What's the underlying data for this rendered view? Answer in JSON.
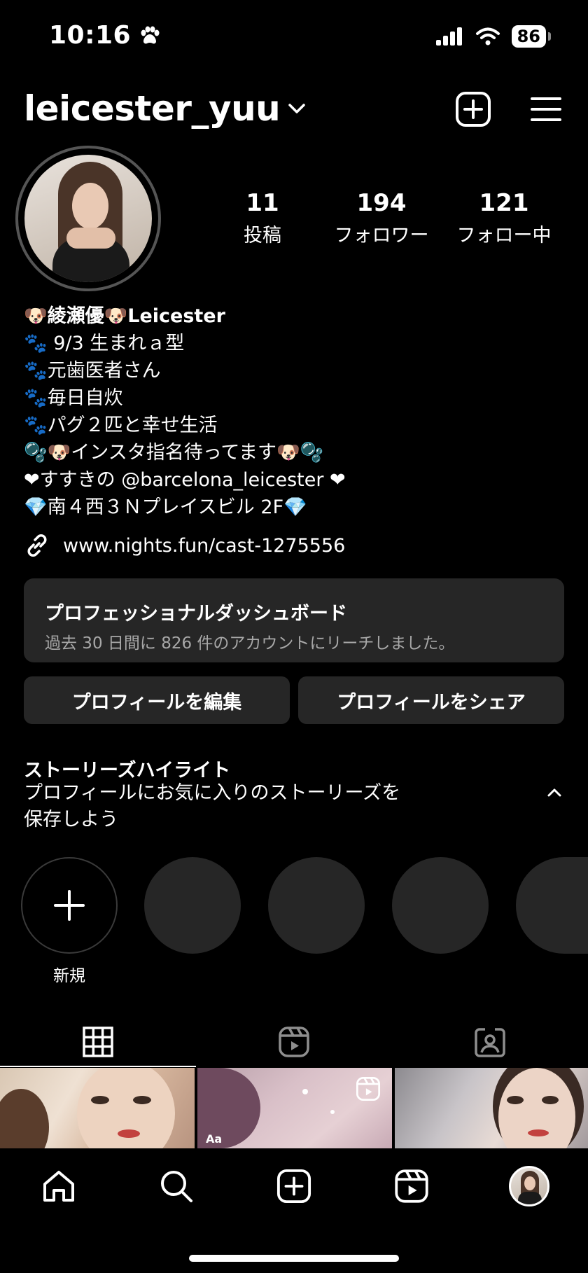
{
  "status_bar": {
    "time": "10:16",
    "battery": "86"
  },
  "header": {
    "username": "leicester_yuu"
  },
  "stats": [
    {
      "num": "11",
      "label": "投稿"
    },
    {
      "num": "194",
      "label": "フォロワー"
    },
    {
      "num": "121",
      "label": "フォロー中"
    }
  ],
  "bio": {
    "name": "🐶綾瀬優🐶Leicester",
    "lines": [
      "🐾 9/3 生まれａ型",
      "🐾元歯医者さん",
      "🐾毎日自炊",
      "🐾パグ２匹と幸せ生活",
      "🫧🐶インスタ指名待ってます🐶🫧",
      "❤すすきの @barcelona_leicester ❤",
      "💎南４西３Ｎプレイスビル 2F💎"
    ],
    "link": "www.nights.fun/cast-1275556"
  },
  "dashboard": {
    "title": "プロフェッショナルダッシュボード",
    "subtitle": "過去 30 日間に 826 件のアカウントにリーチしました。"
  },
  "buttons": {
    "edit": "プロフィールを編集",
    "share": "プロフィールをシェア"
  },
  "highlights": {
    "title": "ストーリーズハイライト",
    "subtitle_1": "プロフィールにお気に入りのストーリーズを",
    "subtitle_2": "保存しよう",
    "new_label": "新規"
  },
  "grid": {
    "thumb2_badge": "Aa"
  },
  "icons": {
    "status_extra": "paw-icon",
    "header_left": "chevron-down-icon",
    "header_right": [
      "add-post-icon",
      "menu-icon"
    ],
    "tabs": [
      "grid-icon",
      "reels-icon",
      "tagged-icon"
    ],
    "nav": [
      "home-icon",
      "search-icon",
      "create-icon",
      "reels-icon",
      "profile-avatar"
    ]
  },
  "colors": {
    "background": "#000000",
    "surface": "#262626",
    "muted_text": "#a8a8a8"
  }
}
